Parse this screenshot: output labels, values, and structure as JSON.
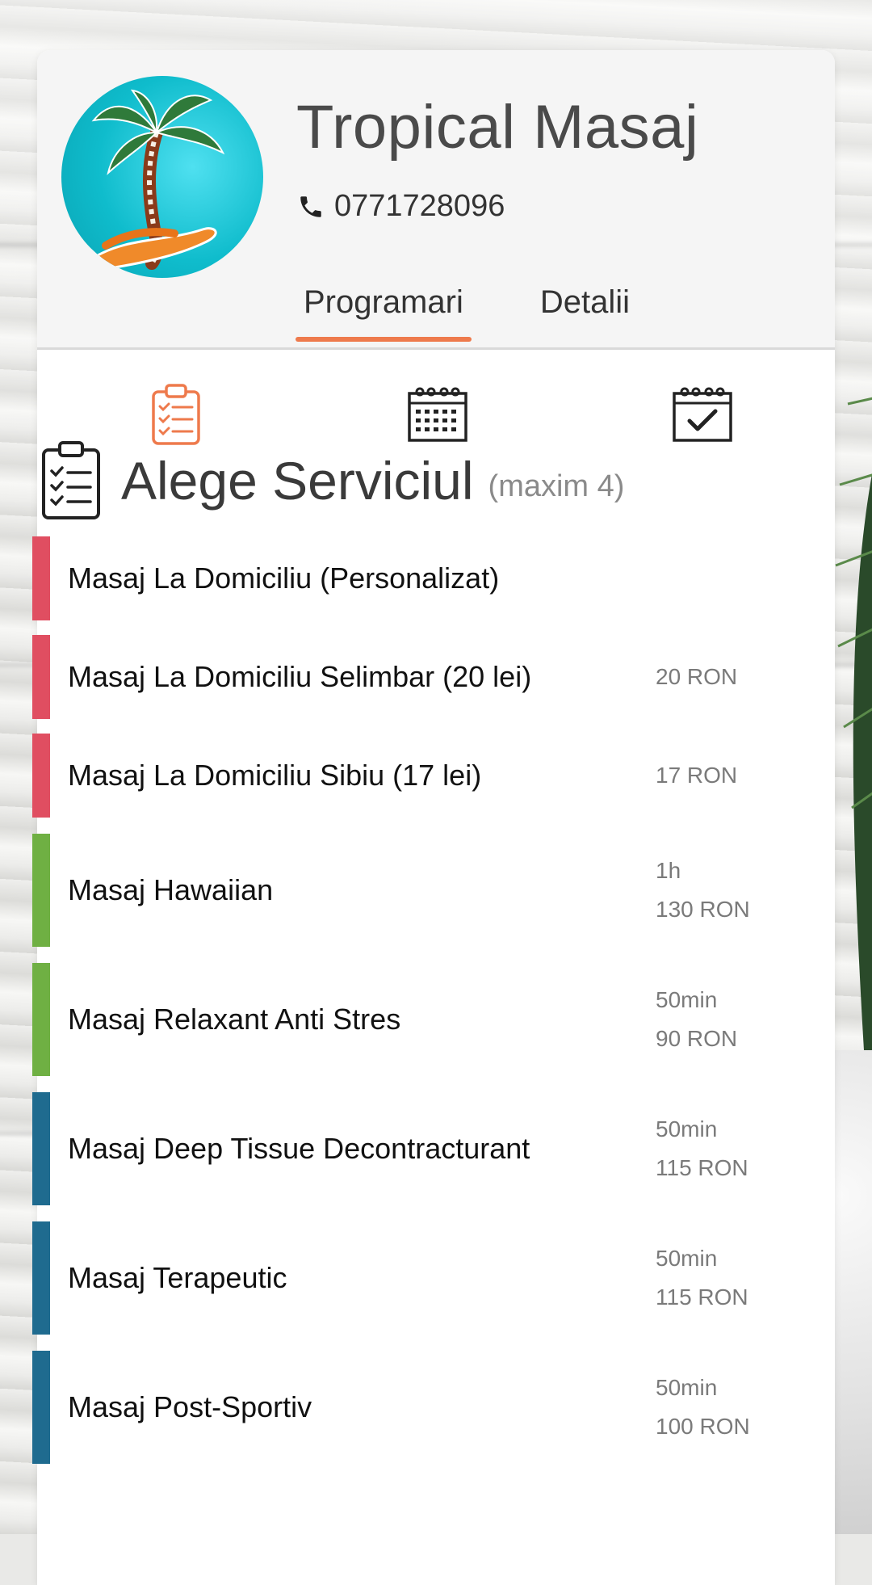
{
  "business": {
    "name": "Tropical Masaj",
    "phone": "0771728096"
  },
  "tabs": [
    {
      "label": "Programari",
      "active": true
    },
    {
      "label": "Detalii",
      "active": false
    }
  ],
  "steps": [
    {
      "icon": "clipboard-checklist-icon",
      "active": true
    },
    {
      "icon": "calendar-icon",
      "active": false
    },
    {
      "icon": "calendar-check-icon",
      "active": false
    }
  ],
  "section": {
    "title": "Alege Serviciul",
    "note": "(maxim 4)"
  },
  "colors": {
    "accent": "#ee7a4c",
    "red": "#e04e61",
    "green": "#6fb043",
    "blue": "#1f6b8f"
  },
  "services": [
    {
      "name": "Masaj La Domiciliu (Personalizat)",
      "duration": "",
      "price": "",
      "color": "#e04e61"
    },
    {
      "name": "Masaj La Domiciliu Selimbar (20 lei)",
      "duration": "",
      "price": "20 RON",
      "color": "#e04e61"
    },
    {
      "name": "Masaj La Domiciliu Sibiu (17 lei)",
      "duration": "",
      "price": "17 RON",
      "color": "#e04e61"
    },
    {
      "name": "Masaj Hawaiian",
      "duration": "1h",
      "price": "130 RON",
      "color": "#6fb043"
    },
    {
      "name": "Masaj Relaxant Anti Stres",
      "duration": "50min",
      "price": "90 RON",
      "color": "#6fb043"
    },
    {
      "name": "Masaj Deep Tissue Decontracturant",
      "duration": "50min",
      "price": "115 RON",
      "color": "#1f6b8f"
    },
    {
      "name": "Masaj Terapeutic",
      "duration": "50min",
      "price": "115 RON",
      "color": "#1f6b8f"
    },
    {
      "name": "Masaj Post-Sportiv",
      "duration": "50min",
      "price": "100 RON",
      "color": "#1f6b8f"
    }
  ]
}
